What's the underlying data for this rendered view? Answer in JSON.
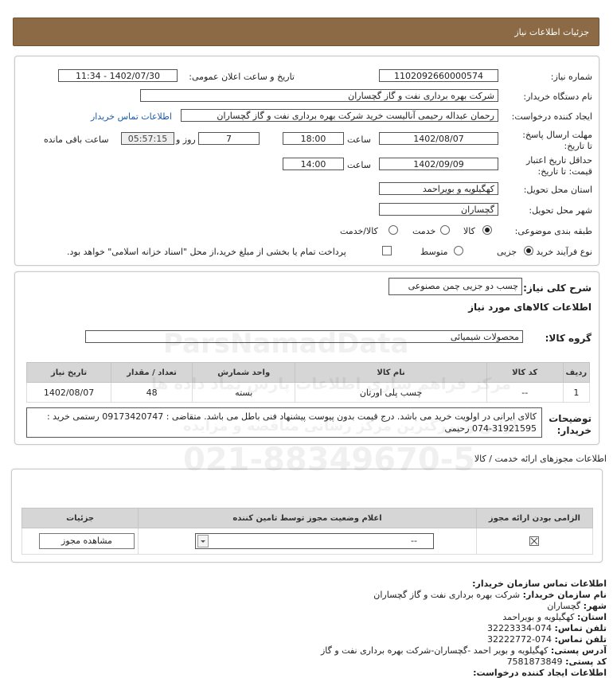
{
  "header": {
    "title": "جزئیات اطلاعات نیاز"
  },
  "details": {
    "need_number_label": "شماره نیاز:",
    "need_number": "1102092660000574",
    "announce_label": "تاریخ و ساعت اعلان عمومی:",
    "announce_value": "1402/07/30 - 11:34",
    "buyer_label": "نام دستگاه خریدار:",
    "buyer_value": "شرکت بهره برداری نفت و گاز گچساران",
    "creator_label": "ایجاد کننده درخواست:",
    "creator_value": "رحمان عبداله رحیمی آنالیست خرید شرکت بهره برداری نفت و گاز گچساران",
    "contact_link": "اطلاعات تماس خریدار",
    "deadline_label": "مهلت ارسال پاسخ: تا تاریخ:",
    "deadline_date": "1402/08/07",
    "time_label": "ساعت",
    "deadline_time": "18:00",
    "days_value": "7",
    "days_label": "روز و",
    "remaining_time": "05:57:15",
    "remaining_label": "ساعت باقی مانده",
    "validity_label": "حداقل تاریخ اعتبار قیمت: تا تاریخ:",
    "validity_date": "1402/09/09",
    "validity_time": "14:00",
    "province_label": "استان محل تحویل:",
    "province_value": "کهگیلویه و بویراحمد",
    "city_label": "شهر محل تحویل:",
    "city_value": "گچساران",
    "category_label": "طبقه بندی موضوعی:",
    "category_options": [
      "کالا",
      "خدمت",
      "کالا/خدمت"
    ],
    "category_selected": "کالا",
    "process_label": "نوع فرآیند خرید :",
    "process_options": [
      "جزیی",
      "متوسط"
    ],
    "process_selected": "جزیی",
    "payment_note": "پرداخت تمام یا بخشی از مبلغ خرید،از محل \"اسناد خزانه اسلامی\" خواهد بود."
  },
  "description": {
    "label": "شرح کلی نیاز:",
    "value": "چسب دو جزیی چمن مصنوعی",
    "goods_info_title": "اطلاعات کالاهای مورد نیاز",
    "group_label": "گروه کالا:",
    "group_value": "محصولات شیمیائی",
    "table": {
      "headers": [
        "ردیف",
        "کد کالا",
        "نام کالا",
        "واحد شمارش",
        "تعداد / مقدار",
        "تاریخ نیاز"
      ],
      "rows": [
        [
          "1",
          "--",
          "چسب پلی اورتان",
          "بسته",
          "48",
          "1402/08/07"
        ]
      ]
    },
    "buyer_notes_label": "توضیحات خریدار:",
    "buyer_notes": "کالای ایرانی در اولویت خرید می باشد. درج قیمت بدون پیوست پیشنهاد فنی باطل می باشد. متقاضی : 09173420747 رستمی خرید : 31921595-074 رحیمی"
  },
  "permits": {
    "title": "اطلاعات مجوزهای ارائه خدمت / کالا",
    "headers": [
      "الزامی بودن ارائه مجوز",
      "اعلام وضعیت مجوز توسط تامین کننده",
      "جزئیات"
    ],
    "select_value": "--",
    "view_button": "مشاهده مجوز"
  },
  "contact": {
    "title": "اطلاعات تماس سازمان خریدار:",
    "org_label": "نام سازمان خریدار:",
    "org_value": "شرکت بهره برداری نفت و گاز گچساران",
    "city_label": "شهر:",
    "city_value": "گچساران",
    "province_label": "استان:",
    "province_value": "کهگیلویه و بویراحمد",
    "phone_label": "تلفن تماس:",
    "phone_value": "074-32223334",
    "fax_label": "تلفن تماس:",
    "fax_value": "074-32222772",
    "address_label": "آدرس پستی:",
    "address_value": "کهگیلویه و بویر احمد -گچساران-شرکت بهره برداری نفت و گاز",
    "postal_label": "کد پستی:",
    "postal_value": "7581873849",
    "more_label": "اطلاعات ایجاد کننده درخواست:"
  },
  "watermark": {
    "brand": "ParsNamadData",
    "phone": "021-88349670-5",
    "text": "مرکز فراهم سازی اطلاعات پارس نماد داده ها",
    "text2": "اولین و بزرگترین مرکز رسانی مناقصه و مزایده"
  }
}
